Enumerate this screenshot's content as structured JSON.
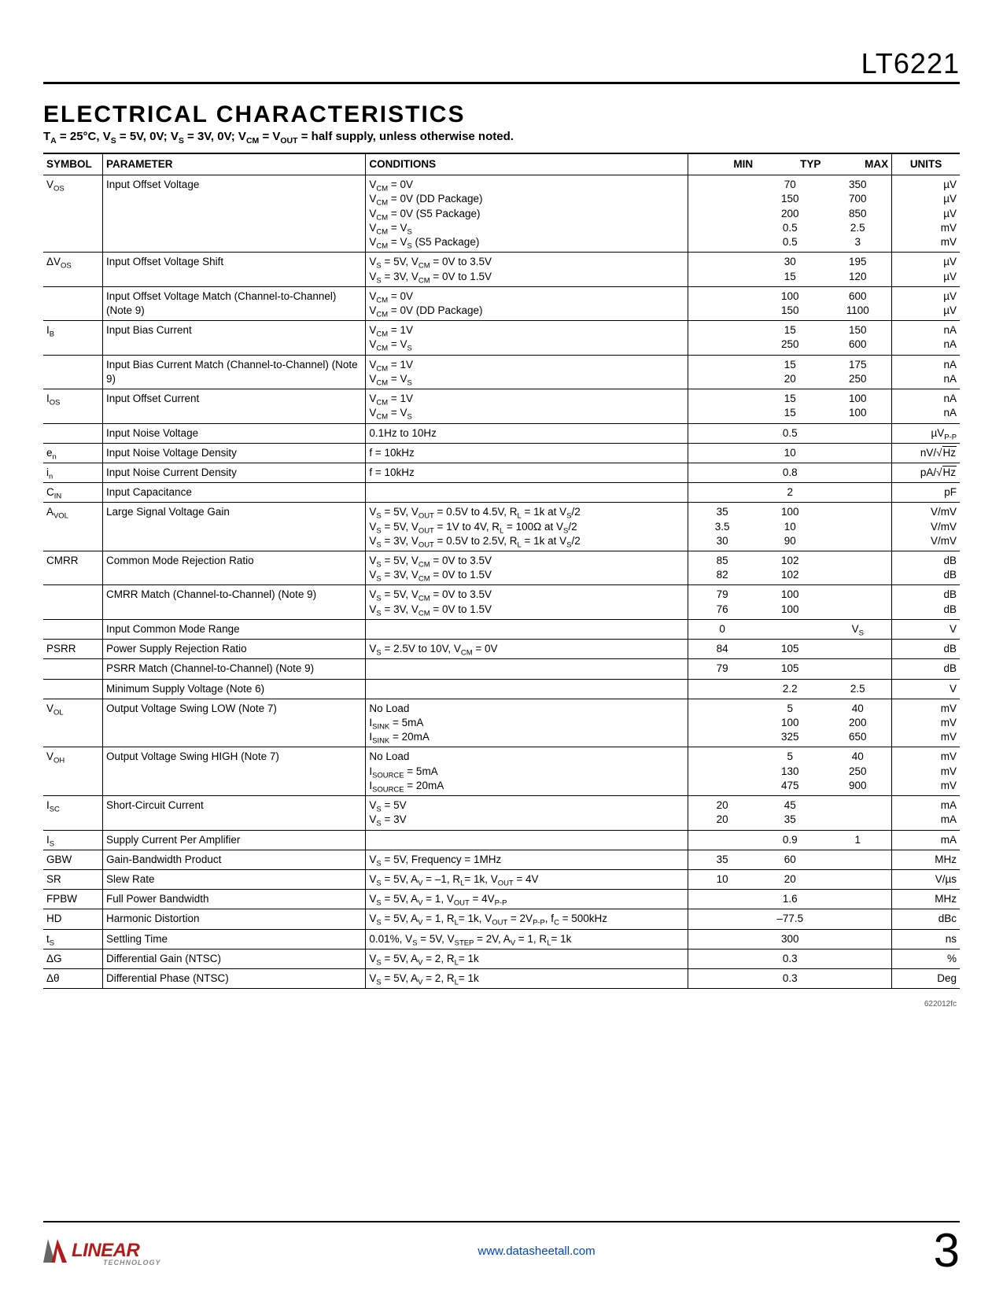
{
  "part_number": "LT6221",
  "section_title": "ELECTRICAL CHARACTERISTICS",
  "condition_note_html": "T<sub>A</sub> = 25°C, V<sub>S</sub> = 5V, 0V; V<sub>S</sub> = 3V, 0V; V<sub>CM</sub> = V<sub>OUT</sub> = half supply, unless otherwise noted.",
  "headers": {
    "symbol": "SYMBOL",
    "parameter": "PARAMETER",
    "conditions": "CONDITIONS",
    "min": "MIN",
    "typ": "TYP",
    "max": "MAX",
    "units": "UNITS"
  },
  "rows": [
    {
      "sym": "V<sub>OS</sub>",
      "param": "Input Offset Voltage",
      "cond": "V<sub>CM</sub> = 0V\nV<sub>CM</sub> = 0V (DD Package)\nV<sub>CM</sub> = 0V (S5 Package)\nV<sub>CM</sub> = V<sub>S</sub>\nV<sub>CM</sub> = V<sub>S</sub> (S5 Package)",
      "min": "",
      "typ": "70\n150\n200\n0.5\n0.5",
      "max": "350\n700\n850\n2.5\n3",
      "unit": "µV\nµV\nµV\nmV\nmV"
    },
    {
      "sym": "ΔV<sub>OS</sub>",
      "param": "Input Offset Voltage Shift",
      "cond": "V<sub>S</sub> = 5V, V<sub>CM</sub> = 0V to 3.5V\nV<sub>S</sub> = 3V, V<sub>CM</sub> = 0V to 1.5V",
      "min": "",
      "typ": "30\n15",
      "max": "195\n120",
      "unit": "µV\nµV"
    },
    {
      "sym": "",
      "param": "Input Offset Voltage Match (Channel-to-Channel) (Note 9)",
      "cond": "V<sub>CM</sub> = 0V\nV<sub>CM</sub> = 0V (DD Package)",
      "min": "",
      "typ": "100\n150",
      "max": "600\n1100",
      "unit": "µV\nµV"
    },
    {
      "sym": "I<sub>B</sub>",
      "param": "Input Bias Current",
      "cond": "V<sub>CM</sub> = 1V\nV<sub>CM</sub> = V<sub>S</sub>",
      "min": "",
      "typ": "15\n250",
      "max": "150\n600",
      "unit": "nA\nnA"
    },
    {
      "sym": "",
      "param": "Input Bias Current Match (Channel-to-Channel) (Note 9)",
      "cond": "V<sub>CM</sub> = 1V\nV<sub>CM</sub> = V<sub>S</sub>",
      "min": "",
      "typ": "15\n20",
      "max": "175\n250",
      "unit": "nA\nnA"
    },
    {
      "sym": "I<sub>OS</sub>",
      "param": "Input Offset Current",
      "cond": "V<sub>CM</sub> = 1V\nV<sub>CM</sub> = V<sub>S</sub>",
      "min": "",
      "typ": "15\n15",
      "max": "100\n100",
      "unit": "nA\nnA"
    },
    {
      "sym": "",
      "param": "Input Noise Voltage",
      "cond": "0.1Hz to 10Hz",
      "min": "",
      "typ": "0.5",
      "max": "",
      "unit": "µV<sub>P-P</sub>"
    },
    {
      "sym": "e<sub>n</sub>",
      "param": "Input Noise Voltage Density",
      "cond": "f = 10kHz",
      "min": "",
      "typ": "10",
      "max": "",
      "unit": "nV/<span class=\"radic\"></span><span class=\"sqrt\">Hz</span>"
    },
    {
      "sym": "i<sub>n</sub>",
      "param": "Input Noise Current Density",
      "cond": "f = 10kHz",
      "min": "",
      "typ": "0.8",
      "max": "",
      "unit": "pA/<span class=\"radic\"></span><span class=\"sqrt\">Hz</span>"
    },
    {
      "sym": "C<sub>IN</sub>",
      "param": "Input Capacitance",
      "cond": "",
      "min": "",
      "typ": "2",
      "max": "",
      "unit": "pF"
    },
    {
      "sym": "A<sub>VOL</sub>",
      "param": "Large Signal Voltage Gain",
      "cond": "V<sub>S</sub> = 5V, V<sub>OUT</sub> = 0.5V to 4.5V, R<sub>L</sub> = 1k at V<sub>S</sub>/2\nV<sub>S</sub> = 5V, V<sub>OUT</sub> = 1V to 4V, R<sub>L</sub> = 100Ω at V<sub>S</sub>/2\nV<sub>S</sub> = 3V, V<sub>OUT</sub> = 0.5V to 2.5V, R<sub>L</sub> = 1k at V<sub>S</sub>/2",
      "min": "35\n3.5\n30",
      "typ": "100\n10\n90",
      "max": "",
      "unit": "V/mV\nV/mV\nV/mV"
    },
    {
      "sym": "CMRR",
      "param": "Common Mode Rejection Ratio",
      "cond": "V<sub>S</sub> = 5V, V<sub>CM</sub> = 0V to 3.5V\nV<sub>S</sub> = 3V, V<sub>CM</sub> = 0V to 1.5V",
      "min": "85\n82",
      "typ": "102\n102",
      "max": "",
      "unit": "dB\ndB"
    },
    {
      "sym": "",
      "param": "CMRR Match (Channel-to-Channel) (Note 9)",
      "cond": "V<sub>S</sub> = 5V, V<sub>CM</sub> = 0V to 3.5V\nV<sub>S</sub> = 3V, V<sub>CM</sub> = 0V to 1.5V",
      "min": "79\n76",
      "typ": "100\n100",
      "max": "",
      "unit": "dB\ndB"
    },
    {
      "sym": "",
      "param": "Input Common Mode Range",
      "cond": "",
      "min": "0",
      "typ": "",
      "max": "V<sub>S</sub>",
      "unit": "V"
    },
    {
      "sym": "PSRR",
      "param": "Power Supply Rejection Ratio",
      "cond": "V<sub>S</sub> = 2.5V to 10V, V<sub>CM</sub> = 0V",
      "min": "84",
      "typ": "105",
      "max": "",
      "unit": "dB"
    },
    {
      "sym": "",
      "param": "PSRR Match (Channel-to-Channel) (Note 9)",
      "cond": "",
      "min": "79",
      "typ": "105",
      "max": "",
      "unit": "dB"
    },
    {
      "sym": "",
      "param": "Minimum Supply Voltage (Note 6)",
      "cond": "",
      "min": "",
      "typ": "2.2",
      "max": "2.5",
      "unit": "V"
    },
    {
      "sym": "V<sub>OL</sub>",
      "param": "Output Voltage Swing LOW (Note 7)",
      "cond": "No Load\nI<sub>SINK</sub> = 5mA\nI<sub>SINK</sub> = 20mA",
      "min": "",
      "typ": "5\n100\n325",
      "max": "40\n200\n650",
      "unit": "mV\nmV\nmV"
    },
    {
      "sym": "V<sub>OH</sub>",
      "param": "Output Voltage Swing HIGH (Note 7)",
      "cond": "No Load\nI<sub>SOURCE</sub> = 5mA\nI<sub>SOURCE</sub> = 20mA",
      "min": "",
      "typ": "5\n130\n475",
      "max": "40\n250\n900",
      "unit": "mV\nmV\nmV"
    },
    {
      "sym": "I<sub>SC</sub>",
      "param": "Short-Circuit Current",
      "cond": "V<sub>S</sub> = 5V\nV<sub>S</sub> = 3V",
      "min": "20\n20",
      "typ": "45\n35",
      "max": "",
      "unit": "mA\nmA"
    },
    {
      "sym": "I<sub>S</sub>",
      "param": "Supply Current Per Amplifier",
      "cond": "",
      "min": "",
      "typ": "0.9",
      "max": "1",
      "unit": "mA"
    },
    {
      "sym": "GBW",
      "param": "Gain-Bandwidth Product",
      "cond": "V<sub>S</sub> = 5V, Frequency = 1MHz",
      "min": "35",
      "typ": "60",
      "max": "",
      "unit": "MHz"
    },
    {
      "sym": "SR",
      "param": "Slew Rate",
      "cond": "V<sub>S</sub> = 5V, A<sub>V</sub> = –1, R<sub>L</sub>= 1k, V<sub>OUT</sub> = 4V",
      "min": "10",
      "typ": "20",
      "max": "",
      "unit": "V/µs"
    },
    {
      "sym": "FPBW",
      "param": "Full Power Bandwidth",
      "cond": "V<sub>S</sub> = 5V, A<sub>V</sub> = 1, V<sub>OUT</sub> = 4V<sub>P-P</sub>",
      "min": "",
      "typ": "1.6",
      "max": "",
      "unit": "MHz"
    },
    {
      "sym": "HD",
      "param": "Harmonic Distortion",
      "cond": "V<sub>S</sub> = 5V, A<sub>V</sub> = 1, R<sub>L</sub>= 1k, V<sub>OUT</sub> = 2V<sub>P-P</sub>, f<sub>C</sub> = 500kHz",
      "min": "",
      "typ": "–77.5",
      "max": "",
      "unit": "dBc"
    },
    {
      "sym": "t<sub>S</sub>",
      "param": "Settling Time",
      "cond": "0.01%, V<sub>S</sub> = 5V, V<sub>STEP</sub> = 2V, A<sub>V</sub> = 1, R<sub>L</sub>= 1k",
      "min": "",
      "typ": "300",
      "max": "",
      "unit": "ns"
    },
    {
      "sym": "ΔG",
      "param": "Differential Gain (NTSC)",
      "cond": "V<sub>S</sub> = 5V, A<sub>V</sub> = 2, R<sub>L</sub>= 1k",
      "min": "",
      "typ": "0.3",
      "max": "",
      "unit": "%"
    },
    {
      "sym": "Δθ",
      "param": "Differential Phase (NTSC)",
      "cond": "V<sub>S</sub> = 5V, A<sub>V</sub> = 2, R<sub>L</sub>= 1k",
      "min": "",
      "typ": "0.3",
      "max": "",
      "unit": "Deg"
    }
  ],
  "doc_id": "622012fc",
  "footer": {
    "brand": "LINEAR",
    "brand_sub": "TECHNOLOGY",
    "url": "www.datasheetall.com",
    "page": "3"
  }
}
